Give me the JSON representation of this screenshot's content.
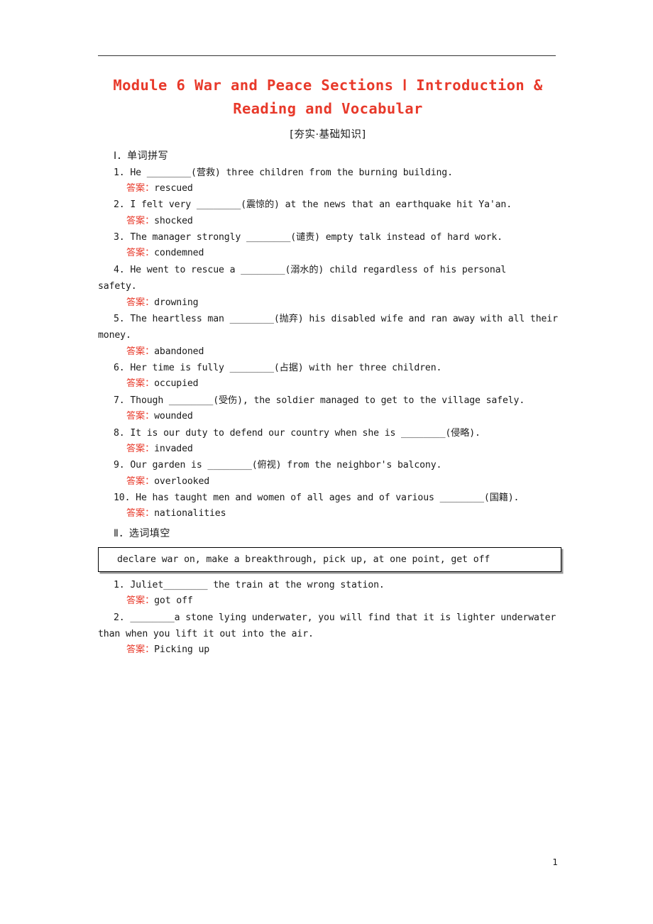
{
  "document": {
    "title": "Module 6 War and Peace Sections Ⅰ Introduction & Reading and Vocabular",
    "subtitle": "[夯实·基础知识]",
    "page_number": "1",
    "answer_label": "答案：",
    "sections": [
      {
        "heading": "Ⅰ．单词拼写",
        "items": [
          {
            "number": "1.",
            "text": "1. He ________(营救) three children from the burning building.",
            "answer": "rescued"
          },
          {
            "number": "2.",
            "text": "2. I felt very ________(震惊的) at the news that an earthquake hit Ya'an.",
            "answer": "shocked"
          },
          {
            "number": "3.",
            "text": "3. The manager strongly ________(谴责) empty talk instead of hard work.",
            "answer": "condemned"
          },
          {
            "number": "4.",
            "text": "4. He went to rescue a ________(溺水的) child regardless of his personal",
            "text2": "safety.",
            "answer": "drowning"
          },
          {
            "number": "5.",
            "text": "5. The heartless man ________(抛弃) his disabled wife and ran away with all their",
            "text2": "money.",
            "answer": "abandoned"
          },
          {
            "number": "6.",
            "text": "6. Her time is fully ________(占据) with her three children.",
            "answer": "occupied"
          },
          {
            "number": "7.",
            "text": "7. Though ________(受伤), the soldier managed to get to the village safely.",
            "answer": "wounded"
          },
          {
            "number": "8.",
            "text": "8. It is our duty to defend our country when she is ________(侵略).",
            "answer": "invaded"
          },
          {
            "number": "9.",
            "text": "9. Our garden is ________(俯视) from the neighbor's balcony.",
            "answer": "overlooked"
          },
          {
            "number": "10.",
            "text": "10. He has taught men and women of all ages and of various ________(国籍).",
            "answer": "nationalities"
          }
        ]
      },
      {
        "heading": "Ⅱ．选词填空",
        "wordbank": "declare war on, make a breakthrough, pick up, at one point, get off",
        "items": [
          {
            "number": "1.",
            "text": "1. Juliet________ the train at the wrong station.",
            "answer": "got off"
          },
          {
            "number": "2.",
            "text": "2. ________a stone lying underwater, you will find that it is lighter underwater",
            "text2": "than when you lift it out into the air.",
            "answer": "Picking up"
          }
        ]
      }
    ]
  }
}
